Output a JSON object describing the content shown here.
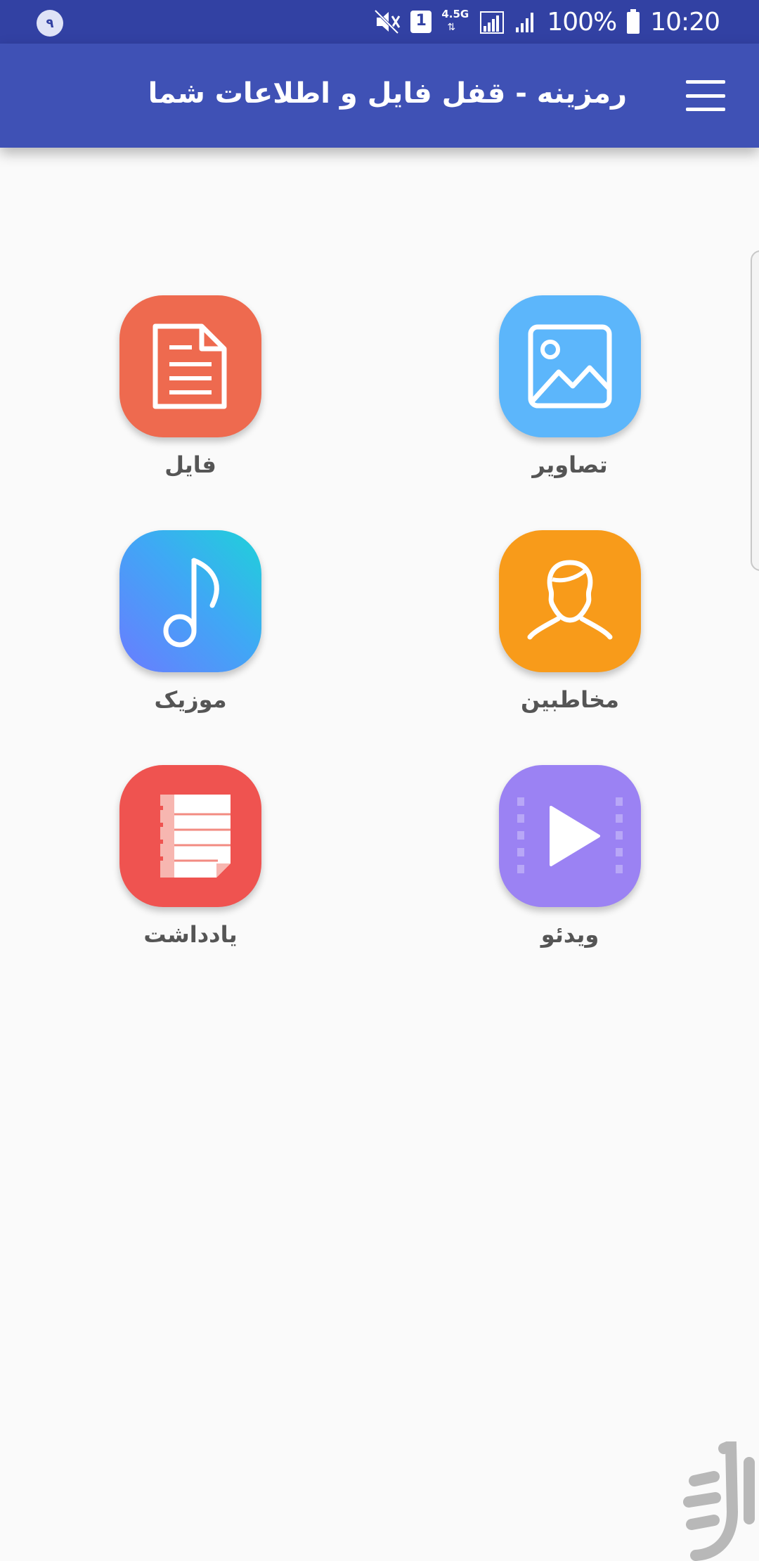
{
  "status_bar": {
    "notification_badge": "۹",
    "sim_label": "1",
    "network_label": "4.5G",
    "battery": "100%",
    "time": "10:20"
  },
  "app_bar": {
    "title": "رمزینه - قفل فایل و اطلاعات شما",
    "menu_icon": "hamburger-menu-icon"
  },
  "colors": {
    "status_bar": "#3241a3",
    "app_bar": "#3f51b5",
    "background": "#fafafa"
  },
  "tiles": [
    {
      "label": "فایل",
      "icon": "document-icon",
      "color": "#ee6a4f"
    },
    {
      "label": "تصاویر",
      "icon": "image-icon",
      "color": "#5cb6fb"
    },
    {
      "label": "موزیک",
      "icon": "music-note-icon",
      "color": "#4fb3ef"
    },
    {
      "label": "مخاطبین",
      "icon": "contact-person-icon",
      "color": "#f89b1a"
    },
    {
      "label": "یادداشت",
      "icon": "notes-icon",
      "color": "#ef5350"
    },
    {
      "label": "ویدئو",
      "icon": "video-play-icon",
      "color": "#9b82f3"
    }
  ]
}
